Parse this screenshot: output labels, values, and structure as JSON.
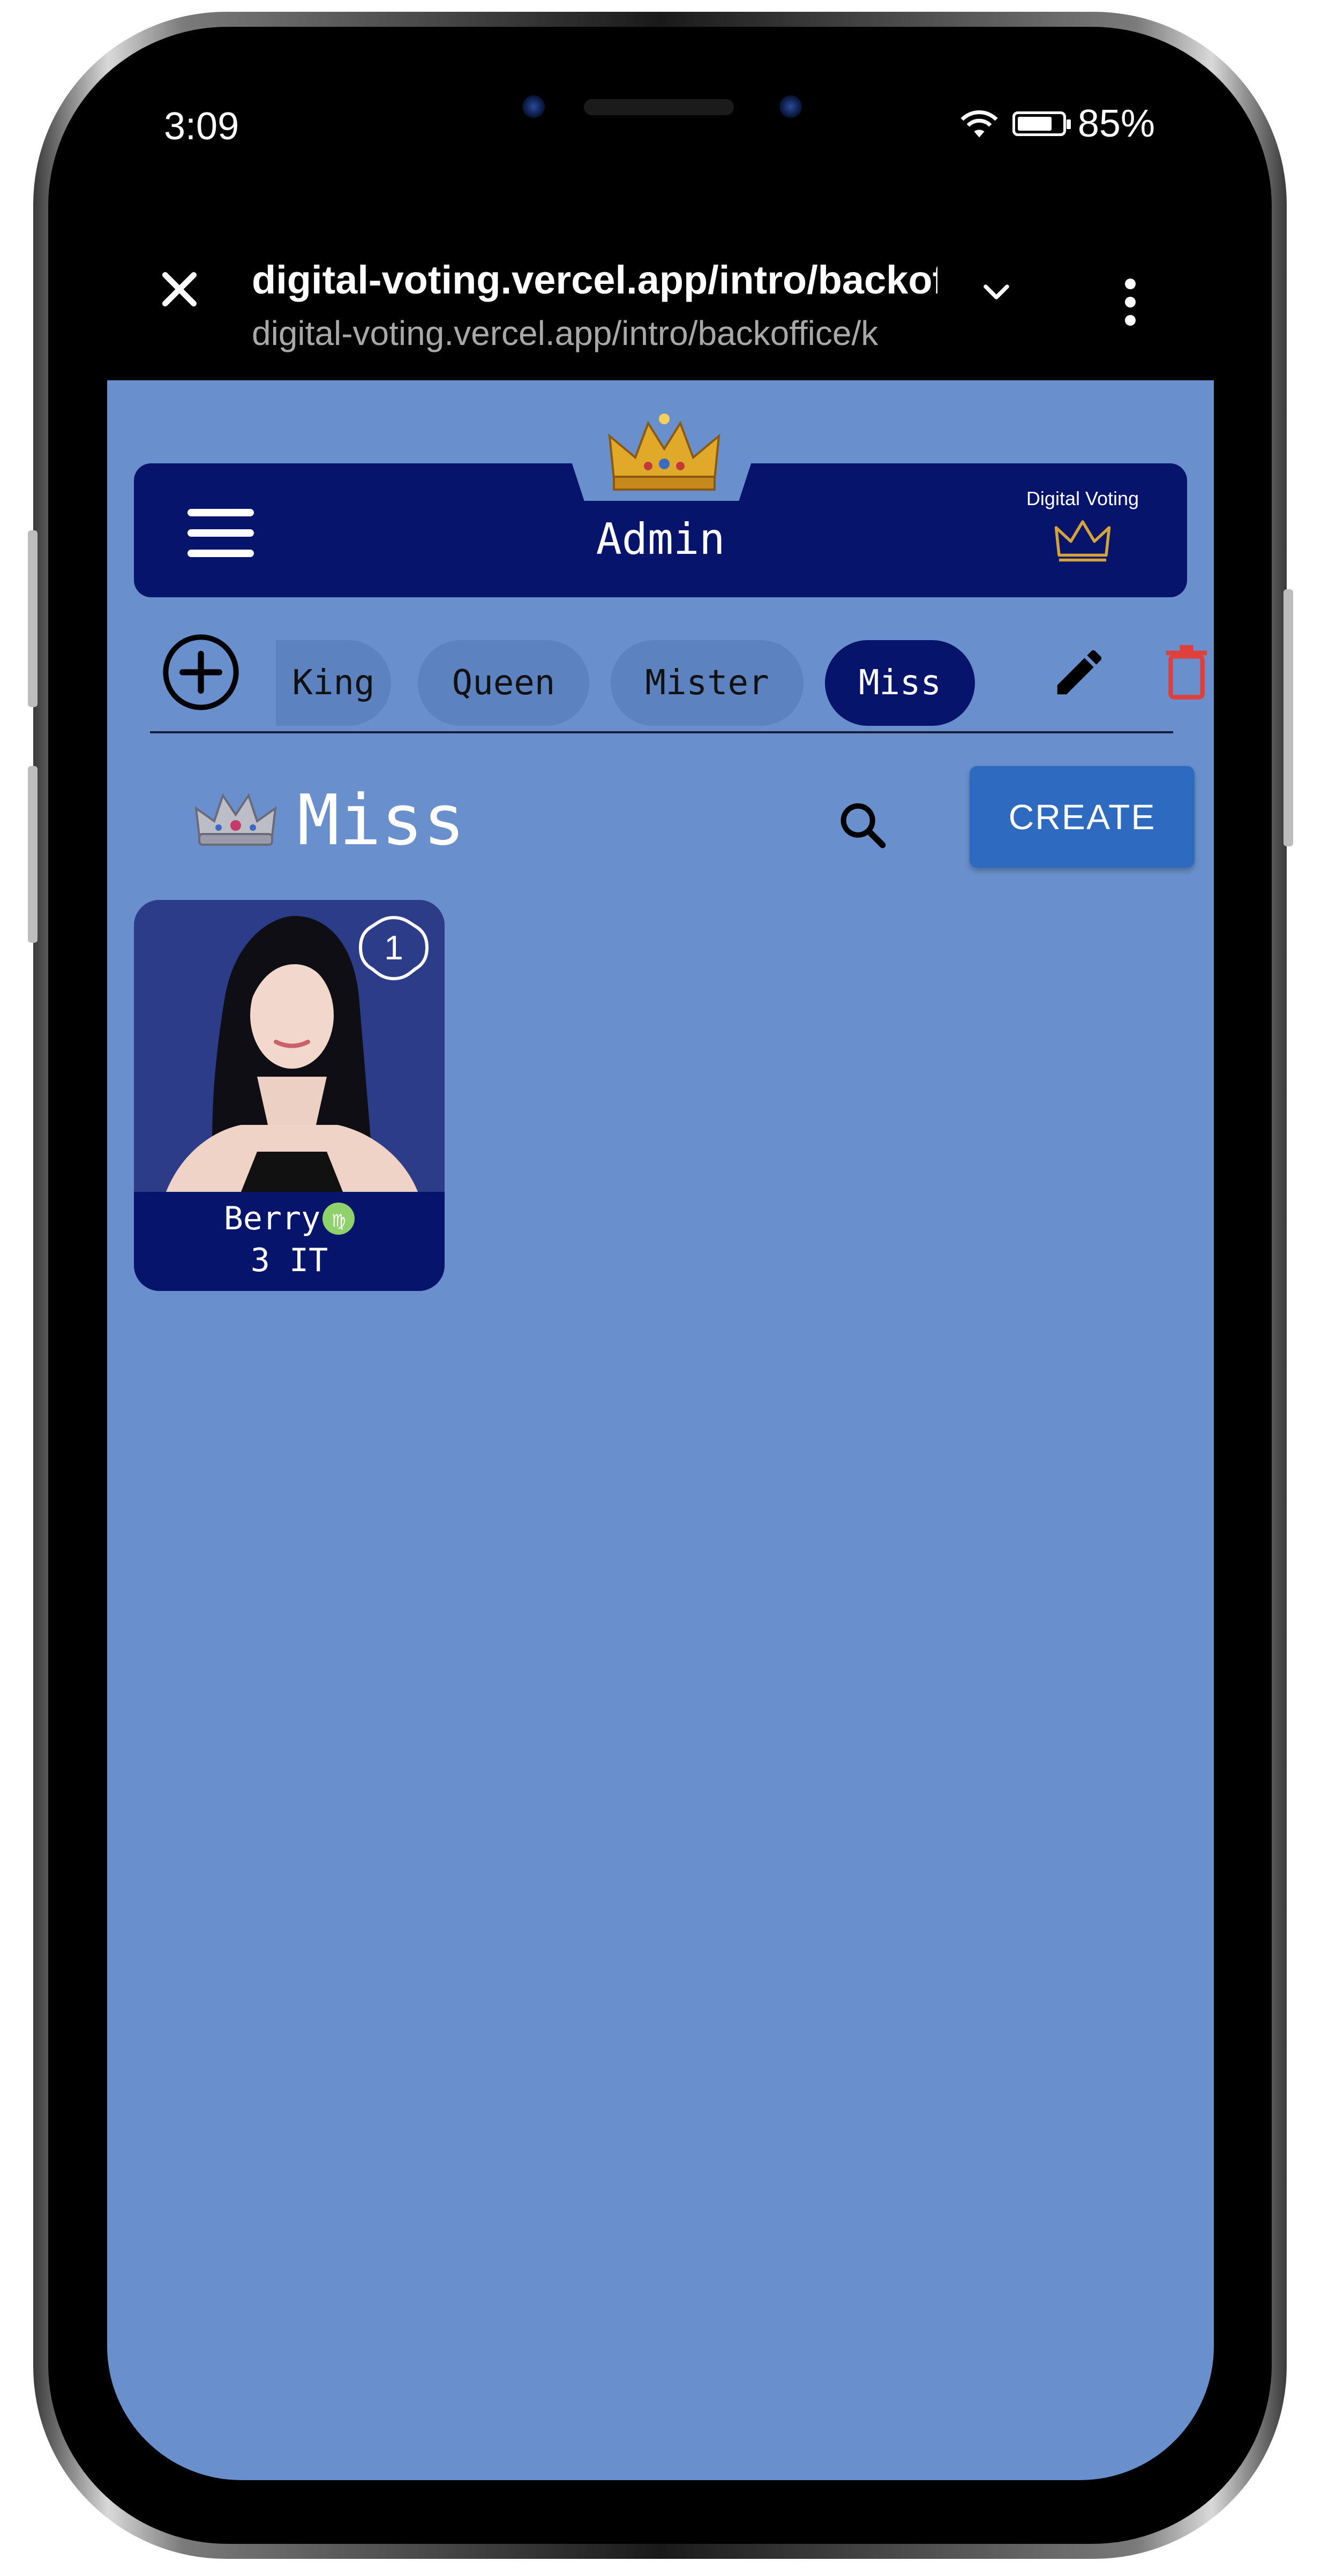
{
  "status_bar": {
    "time": "3:09",
    "battery": "85%"
  },
  "browser": {
    "url_title": "digital-voting.vercel.app/intro/backoffice/k",
    "url_full": "digital-voting.vercel.app/intro/backoffice/k"
  },
  "header": {
    "title": "Admin",
    "brand": "Digital Voting"
  },
  "tabs": [
    {
      "label": "King"
    },
    {
      "label": "Queen"
    },
    {
      "label": "Mister"
    },
    {
      "label": "Miss"
    }
  ],
  "active_tab": "Miss",
  "section": {
    "title": "Miss",
    "create_label": "CREATE"
  },
  "candidates": [
    {
      "number": "1",
      "name": "Berry",
      "zodiac": "♍",
      "class": "3 IT"
    }
  ],
  "colors": {
    "background": "#6990cc",
    "navy": "#07146b",
    "create_button": "#2f6ac1",
    "delete_icon": "#e0403c",
    "virgo_badge": "#8fd16a"
  },
  "icons": [
    "close-icon",
    "chevron-down-icon",
    "more-vertical-icon",
    "menu-icon",
    "crown-icon",
    "add-circle-icon",
    "edit-icon",
    "delete-icon",
    "search-icon"
  ]
}
